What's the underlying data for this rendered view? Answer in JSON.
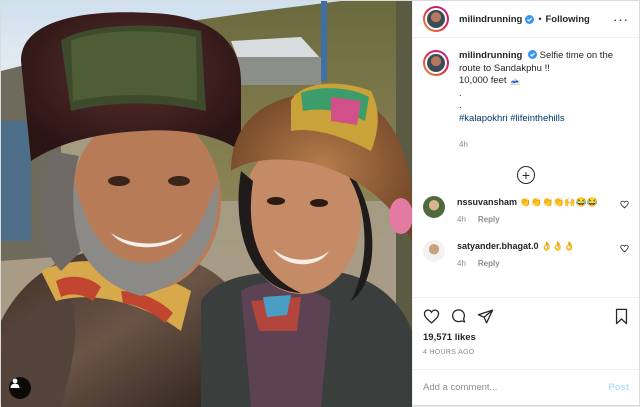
{
  "post": {
    "username": "milindrunning",
    "follow_label": "Following",
    "dot": "•",
    "more": "···",
    "caption": {
      "username": "milindrunning",
      "text": "Selfie time on the route to Sandakphu !!",
      "altitude": "10,000 feet",
      "altitude_glyph": "🗻",
      "line3": ".",
      "line4": ".",
      "hashtags": "#kalapokhri #lifeinthehills",
      "time": "4h"
    },
    "load_more": "+",
    "comments": [
      {
        "username": "nssuvansham",
        "text": "👏👏👏👏🙌😂😂",
        "time": "4h",
        "reply": "Reply"
      },
      {
        "username": "satyander.bhagat.0",
        "text": "👌👌👌",
        "time": "4h",
        "reply": "Reply"
      }
    ],
    "likes": "19,571 likes",
    "time_ago": "4 HOURS AGO",
    "add_comment": {
      "placeholder": "Add a comment...",
      "post_label": "Post"
    }
  },
  "colors": {
    "link": "#00376b",
    "meta": "#8e8e8e",
    "post_disabled": "#b2dffc",
    "verified": "#3897f0"
  },
  "icons": [
    "user-tag-icon",
    "verified-icon",
    "more-icon",
    "add-circle-icon",
    "heart-icon",
    "comment-icon",
    "share-icon",
    "save-icon"
  ]
}
